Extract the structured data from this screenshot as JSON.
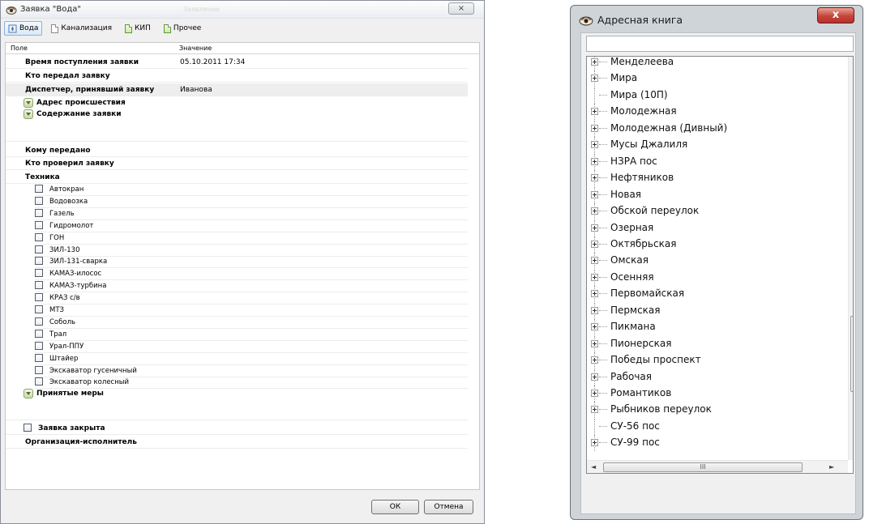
{
  "dialog": {
    "title": "Заявка \"Вода\"",
    "faint_title": "Заявление",
    "close_glyph": "×",
    "tabs": [
      {
        "label": "Вода"
      },
      {
        "label": "Канализация"
      },
      {
        "label": "КИП"
      },
      {
        "label": "Прочее"
      }
    ],
    "grid": {
      "col_field": "Поле",
      "col_value": "Значение",
      "rows": [
        {
          "label": "Время поступления заявки",
          "value": "05.10.2011 17:34"
        },
        {
          "label": "Кто передал заявку",
          "value": ""
        },
        {
          "label": "Диспетчер, принявший заявку",
          "value": "Иванова"
        }
      ],
      "section_address": "Адрес происшествия",
      "section_content": "Содержание заявки",
      "rows2": [
        {
          "label": "Кому передано"
        },
        {
          "label": "Кто проверил заявку"
        },
        {
          "label": "Техника"
        }
      ],
      "equipment": [
        "Автокран",
        "Водовозка",
        "Газель",
        "Гидромолот",
        "ГОН",
        "ЗИЛ-130",
        "ЗИЛ-131-сварка",
        "КАМАЗ-илосос",
        "КАМАЗ-турбина",
        "КРАЗ с/в",
        "МТЗ",
        "Соболь",
        "Трал",
        "Урал-ППУ",
        "Штайер",
        "Экскаватор гусеничный",
        "Экскаватор колесный"
      ],
      "section_measures": "Принятые меры",
      "closed_label": "Заявка закрыта",
      "org_label": "Организация-исполнитель"
    },
    "ok_label": "ОК",
    "cancel_label": "Отмена"
  },
  "address_book": {
    "title": "Адресная книга",
    "close_glyph": "x",
    "search_value": "",
    "items": [
      {
        "label": "Менделеева",
        "expandable": true
      },
      {
        "label": "Мира",
        "expandable": true
      },
      {
        "label": "Мира (10П)",
        "expandable": false
      },
      {
        "label": "Молодежная",
        "expandable": true
      },
      {
        "label": "Молодежная (Дивный)",
        "expandable": true
      },
      {
        "label": "Мусы Джалиля",
        "expandable": true
      },
      {
        "label": "НЗРА пос",
        "expandable": true
      },
      {
        "label": "Нефтяников",
        "expandable": true
      },
      {
        "label": "Новая",
        "expandable": true
      },
      {
        "label": "Обской переулок",
        "expandable": true
      },
      {
        "label": "Озерная",
        "expandable": true
      },
      {
        "label": "Октябрьская",
        "expandable": true
      },
      {
        "label": "Омская",
        "expandable": true
      },
      {
        "label": "Осенняя",
        "expandable": true
      },
      {
        "label": "Первомайская",
        "expandable": true
      },
      {
        "label": "Пермская",
        "expandable": true
      },
      {
        "label": "Пикмана",
        "expandable": true
      },
      {
        "label": "Пионерская",
        "expandable": true
      },
      {
        "label": "Победы проспект",
        "expandable": true
      },
      {
        "label": "Рабочая",
        "expandable": true
      },
      {
        "label": "Романтиков",
        "expandable": true
      },
      {
        "label": "Рыбников переулок",
        "expandable": true
      },
      {
        "label": "СУ-56 пос",
        "expandable": false
      },
      {
        "label": "СУ-99 пос",
        "expandable": true
      }
    ],
    "hscroll_grip": "III"
  }
}
